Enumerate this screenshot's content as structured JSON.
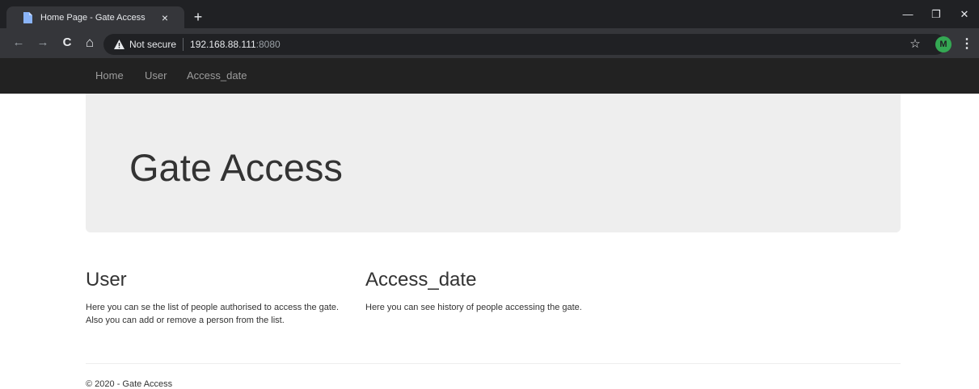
{
  "browser": {
    "tab": {
      "title": "Home Page - Gate Access",
      "close_glyph": "×",
      "favicon_icon": "page-icon"
    },
    "new_tab_glyph": "+",
    "window_controls": {
      "minimize": "—",
      "restore": "❐",
      "close": "✕"
    },
    "nav": {
      "back": "←",
      "forward": "→",
      "reload": "C",
      "home": "⌂"
    },
    "omnibox": {
      "security_text": "Not secure",
      "url_host": "192.168.88.111",
      "url_port": ":8080"
    },
    "bookmark_glyph": "☆",
    "profile_initial": "M",
    "menu_glyph": "⋮"
  },
  "navbar": {
    "items": [
      {
        "label": "Home"
      },
      {
        "label": "User"
      },
      {
        "label": "Access_date"
      }
    ]
  },
  "jumbotron": {
    "title": "Gate Access"
  },
  "columns": [
    {
      "heading": "User",
      "text": "Here you can se the list of people authorised to access the gate. Also you can add or remove a person from the list."
    },
    {
      "heading": "Access_date",
      "text": "Here you can see history of people accessing the gate."
    }
  ],
  "footer": {
    "text": "© 2020 - Gate Access"
  },
  "colors": {
    "chrome_dark": "#202124",
    "chrome_toolbar": "#35363a",
    "navbar_bg": "#222222",
    "navbar_link": "#9d9d9d",
    "jumbotron_bg": "#eeeeee",
    "text": "#333333",
    "profile_avatar": "#34a853"
  }
}
